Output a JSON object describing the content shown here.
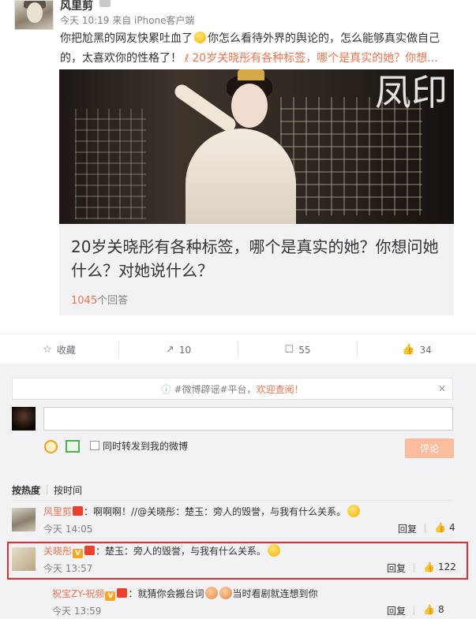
{
  "post": {
    "username": "风里剪",
    "meta": "今天 10:19 来自 iPhone客户端",
    "text_part1": "你把尬黑的网友快累吐血了",
    "text_part2": "你怎么看待外界的舆论的，怎么能够真实做自己的，太喜欢你的性格了！",
    "link_text": "20岁关晓彤有各种标签，哪个是真实的她？你想...",
    "link_icon": "link-icon"
  },
  "share_card": {
    "title": "20岁关晓彤有各种标签，哪个是真实的她？你想问她什么？对她说什么？",
    "answer_count": "1045",
    "answer_label": "个回答",
    "image_logo_text": "凤印"
  },
  "actions": {
    "favorite_label": "收藏",
    "repost_count": "10",
    "comment_count": "55",
    "like_count": "34"
  },
  "comment_box": {
    "notice_prefix": "#微博辟谣#平台，",
    "notice_link": "欢迎查阅！",
    "notice_close": "✕",
    "repost_label": "同时转发到我的微博",
    "submit_label": "评论"
  },
  "sort": {
    "hot": "按热度",
    "time": "按时间"
  },
  "comments": [
    {
      "name": "风里剪",
      "text": "：啊啊啊！//@关晓彤：楚玉：旁人的毁誉，与我有什么关系。",
      "time": "今天 14:05",
      "reply": "回复",
      "likes": "4"
    },
    {
      "name": "关晓彤",
      "text": "：楚玉：旁人的毁誉，与我有什么关系。",
      "time": "今天 13:57",
      "reply": "回复",
      "likes": "122"
    },
    {
      "name": "祝宝ZY-祝频",
      "text": "：就猜你会搬台词",
      "text2": "当时看剧就连想到你",
      "time": "今天 13:59",
      "reply": "回复",
      "likes": "8"
    }
  ],
  "colors": {
    "accent": "#eb7350",
    "highlight": "#e52d2d",
    "submit": "#fbbd9e"
  }
}
